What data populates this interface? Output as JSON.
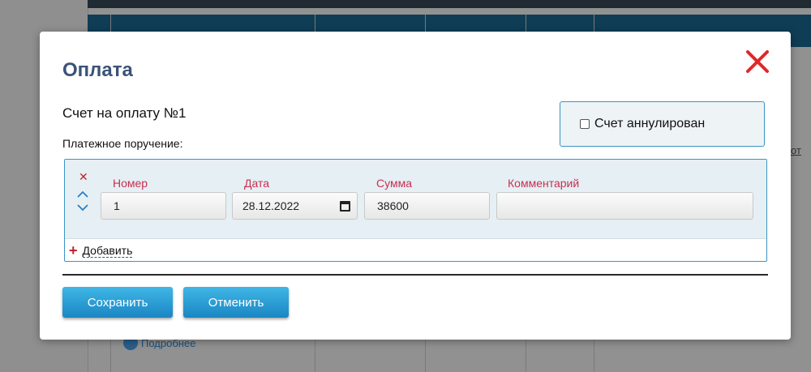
{
  "background": {
    "more_link": "Подробнее",
    "side_link": "от"
  },
  "modal": {
    "title": "Оплата",
    "invoice_title": "Счет на оплату №1",
    "payment_label": "Платежное поручение:",
    "annulled_label": "Счет аннулирован",
    "annulled_checked": false,
    "columns": {
      "number": "Номер",
      "date": "Дата",
      "amount": "Сумма",
      "comment": "Комментарий"
    },
    "row": {
      "number": "1",
      "date": "28.12.2022",
      "amount": "38600",
      "comment": ""
    },
    "add_label": "Добавить",
    "save_label": "Сохранить",
    "cancel_label": "Отменить"
  },
  "colors": {
    "accent": "#1b86c3",
    "title": "#3b5377",
    "label": "#c73052",
    "close": "#e0262a"
  }
}
